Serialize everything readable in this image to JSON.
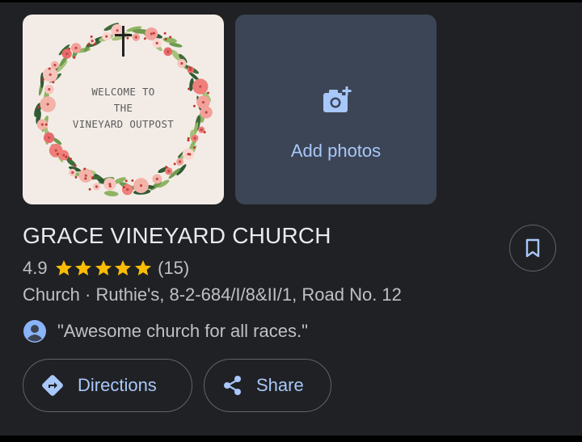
{
  "photo": {
    "welcome_line1": "WELCOME TO",
    "welcome_line2": "THE",
    "welcome_line3": "VINEYARD OUTPOST"
  },
  "add_photos": {
    "label": "Add photos",
    "icon": "add-photo-camera-icon"
  },
  "place": {
    "name": "GRACE VINEYARD CHURCH",
    "rating": "4.9",
    "stars": 5,
    "review_count": "(15)",
    "category_address": "Church · Ruthie's, 8-2-684/I/8&II/1, Road No. 12",
    "review_quote": "\"Awesome church for all races.\""
  },
  "actions": {
    "directions_label": "Directions",
    "share_label": "Share",
    "save_icon": "bookmark-icon"
  },
  "colors": {
    "background": "#202124",
    "accent": "#a8c7fa",
    "star": "#fbbc04",
    "card": "#3c4555"
  }
}
